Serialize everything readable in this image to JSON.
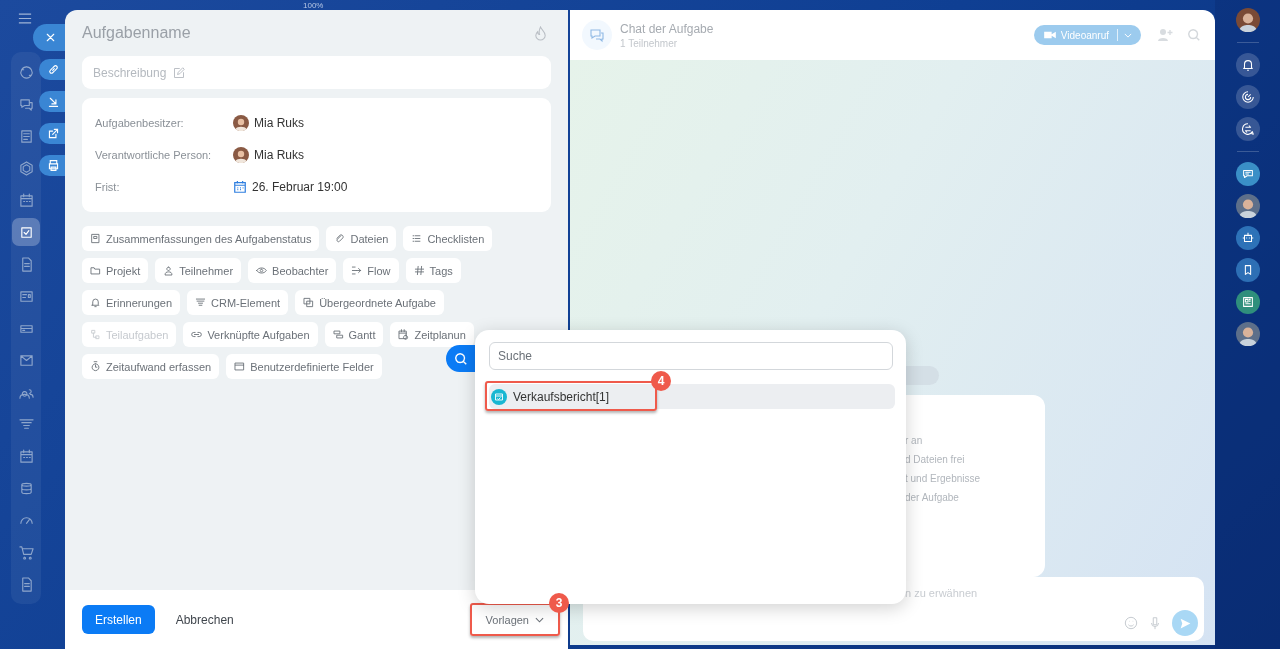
{
  "zoom_label": "100%",
  "nav": {
    "items": [
      {
        "kind": "ring",
        "selected": false
      },
      {
        "kind": "chats",
        "selected": false
      },
      {
        "kind": "feed",
        "selected": false
      },
      {
        "kind": "hexagon",
        "selected": false
      },
      {
        "kind": "calendar",
        "selected": false
      },
      {
        "kind": "tasks",
        "selected": true
      },
      {
        "kind": "document",
        "selected": false
      },
      {
        "kind": "card",
        "selected": false
      },
      {
        "kind": "drive",
        "selected": false
      },
      {
        "kind": "mail",
        "selected": false
      },
      {
        "kind": "contacts",
        "selected": false
      },
      {
        "kind": "funnel",
        "selected": false
      },
      {
        "kind": "calendar",
        "selected": false
      },
      {
        "kind": "database",
        "selected": false
      },
      {
        "kind": "gauge",
        "selected": false
      },
      {
        "kind": "cart",
        "selected": false
      },
      {
        "kind": "document",
        "selected": false
      }
    ]
  },
  "quick_actions": [
    {
      "kind": "close"
    },
    {
      "kind": "link"
    },
    {
      "kind": "download"
    },
    {
      "kind": "external"
    },
    {
      "kind": "print"
    }
  ],
  "task": {
    "title": "Aufgabenname",
    "description": {
      "placeholder": "Beschreibung"
    },
    "fields": [
      {
        "label": "Aufgabenbesitzer:",
        "value": "Mia Ruks",
        "kind": "person"
      },
      {
        "label": "Verantwortliche Person:",
        "value": "Mia Ruks",
        "kind": "person"
      },
      {
        "label": "Frist:",
        "value": "26. Februar 19:00",
        "kind": "date"
      }
    ],
    "chip_rows": [
      [
        {
          "label": "Zusammenfassungen des Aufgabenstatus",
          "kind": "summary",
          "disabled": false
        },
        {
          "label": "Dateien",
          "kind": "files",
          "disabled": false
        },
        {
          "label": "Checklisten",
          "kind": "checklist",
          "disabled": false
        }
      ],
      [
        {
          "label": "Projekt",
          "kind": "project",
          "disabled": false
        },
        {
          "label": "Teilnehmer",
          "kind": "participants",
          "disabled": false
        },
        {
          "label": "Beobachter",
          "kind": "observers",
          "disabled": false
        },
        {
          "label": "Flow",
          "kind": "flow",
          "disabled": false
        },
        {
          "label": "Tags",
          "kind": "tags",
          "disabled": false
        }
      ],
      [
        {
          "label": "Erinnerungen",
          "kind": "reminders",
          "disabled": false
        },
        {
          "label": "CRM-Element",
          "kind": "crm",
          "disabled": false
        },
        {
          "label": "Übergeordnete Aufgabe",
          "kind": "parent",
          "disabled": false
        }
      ],
      [
        {
          "label": "Teilaufgaben",
          "kind": "subtasks",
          "disabled": true
        },
        {
          "label": "Verknüpfte Aufgaben",
          "kind": "linked",
          "disabled": false
        },
        {
          "label": "Gantt",
          "kind": "gantt",
          "disabled": false
        },
        {
          "label": "Zeitplanun",
          "kind": "planning",
          "disabled": false
        }
      ],
      [
        {
          "label": "Zeitaufwand erfassen",
          "kind": "timetrack",
          "disabled": false
        },
        {
          "label": "Benutzerdefinierte Felder",
          "kind": "fields",
          "disabled": false
        }
      ]
    ]
  },
  "footer": {
    "create": "Erstellen",
    "cancel": "Abbrechen",
    "templates": "Vorlagen",
    "templates_marker": "3"
  },
  "templates_menu": {
    "search": {
      "placeholder": "Suche"
    },
    "items": [
      {
        "label": "Verkaufsbericht[1]",
        "selected": true,
        "marker": "4"
      }
    ]
  },
  "chat": {
    "title": "Chat der Aufgabe",
    "subtitle": "1 Teilnehmer",
    "video_button": "Videoanruf",
    "card_lines": [
      "r an",
      "d Dateien frei",
      "t und Ergebnisse",
      "der Aufgabe"
    ],
    "input": {
      "placeholder": "n zu erwähnen"
    }
  },
  "right_bar": {
    "items": [
      {
        "kind": "avatar"
      },
      {
        "kind": "bell"
      },
      {
        "kind": "spiral"
      },
      {
        "kind": "swap"
      },
      {
        "kind": "app-chat"
      },
      {
        "kind": "avatar"
      },
      {
        "kind": "robot"
      },
      {
        "kind": "bookmark"
      },
      {
        "kind": "news"
      },
      {
        "kind": "avatar"
      }
    ]
  }
}
